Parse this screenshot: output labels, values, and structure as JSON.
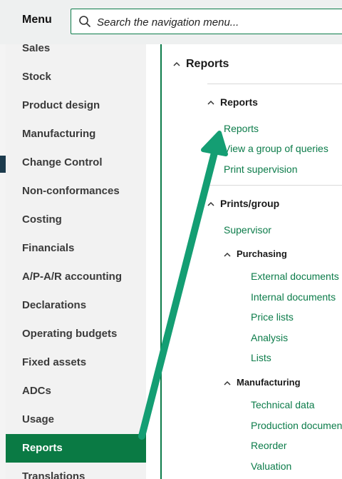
{
  "header": {
    "menu_title": "Menu",
    "search_placeholder": "Search the navigation menu..."
  },
  "sidebar": {
    "items": [
      {
        "label": "Sales"
      },
      {
        "label": "Stock"
      },
      {
        "label": "Product design"
      },
      {
        "label": "Manufacturing"
      },
      {
        "label": "Change Control"
      },
      {
        "label": "Non-conformances"
      },
      {
        "label": "Costing"
      },
      {
        "label": "Financials"
      },
      {
        "label": "A/P-A/R accounting"
      },
      {
        "label": "Declarations"
      },
      {
        "label": "Operating budgets"
      },
      {
        "label": "Fixed assets"
      },
      {
        "label": "ADCs"
      },
      {
        "label": "Usage"
      },
      {
        "label": "Reports",
        "active": true
      },
      {
        "label": "Translations"
      }
    ]
  },
  "content": {
    "title": "Reports",
    "groups": [
      {
        "title": "Reports",
        "links": [
          "Reports",
          "View a group of queries",
          "Print supervision"
        ]
      },
      {
        "title": "Prints/group",
        "links": [
          "Supervisor"
        ],
        "subgroups": [
          {
            "title": "Purchasing",
            "links": [
              "External documents",
              "Internal documents",
              "Price lists",
              "Analysis",
              "Lists"
            ]
          },
          {
            "title": "Manufacturing",
            "links": [
              "Technical data",
              "Production documents",
              "Reorder",
              "Valuation"
            ]
          }
        ]
      }
    ]
  },
  "colors": {
    "accent": "#0c7c4a",
    "active_bg": "#0a7a44",
    "annotation_arrow": "#149e73"
  },
  "icons": {
    "search": "search-icon",
    "collapse": "chevron-up-icon"
  }
}
